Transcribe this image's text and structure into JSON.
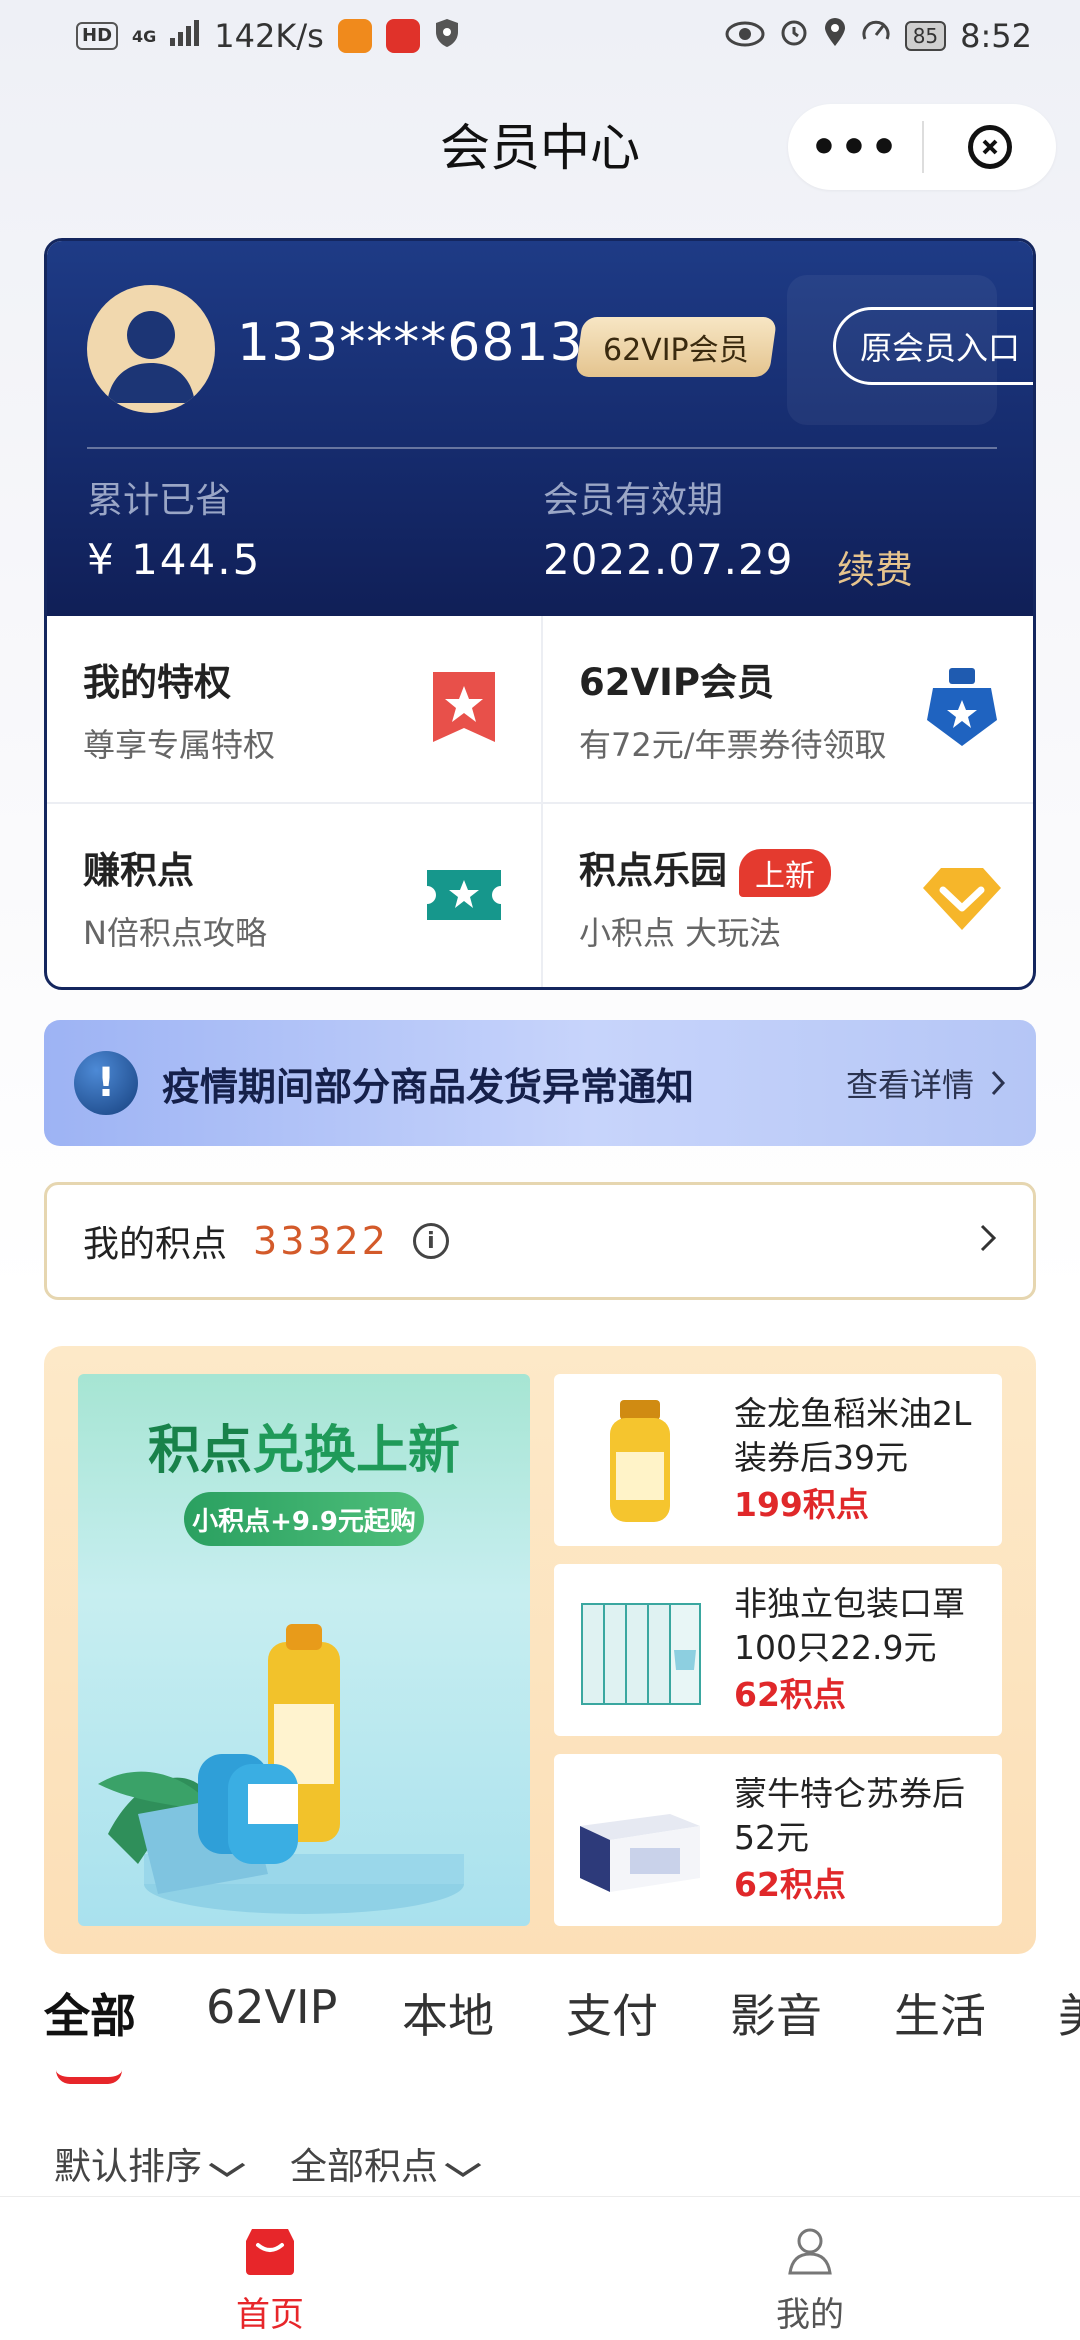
{
  "status_bar": {
    "left_badges": [
      "HD",
      "4G"
    ],
    "speed": "142K/s",
    "battery": "85",
    "time": "8:52"
  },
  "header": {
    "title": "会员中心",
    "more": "•••"
  },
  "card": {
    "phone": "133****6813",
    "vip_badge": "62VIP会员",
    "old_entry": "原会员入口",
    "saved_label": "累计已省",
    "saved_value": "¥ 144.5",
    "expiry_label": "会员有效期",
    "expiry_value": "2022.07.29",
    "renew": "续费"
  },
  "grid": [
    {
      "title": "我的特权",
      "subtitle": "尊享专属特权",
      "icon": "bookmark-star-icon"
    },
    {
      "title": "62VIP会员",
      "subtitle": "有72元/年票券待领取",
      "icon": "medal-star-icon"
    },
    {
      "title": "赚积点",
      "subtitle": "N倍积点攻略",
      "icon": "ticket-star-icon"
    },
    {
      "title": "积点乐园",
      "tag": "上新",
      "subtitle": "小积点 大玩法",
      "icon": "diamond-icon"
    }
  ],
  "notice": {
    "icon": "!",
    "text": "疫情期间部分商品发货异常通知",
    "link": "查看详情"
  },
  "points": {
    "label": "我的积点",
    "value": "33322"
  },
  "promo": {
    "banner_title_a": "积点",
    "banner_title_b": "兑换上新",
    "banner_pill": "小积点+9.9元起购",
    "products": [
      {
        "name": "金龙鱼稻米油2L装券后39元",
        "points": "199积点"
      },
      {
        "name": "非独立包装口罩100只22.9元",
        "points": "62积点"
      },
      {
        "name": "蒙牛特仑苏券后52元",
        "points": "62积点"
      }
    ]
  },
  "tabs": [
    "全部",
    "62VIP",
    "本地",
    "支付",
    "影音",
    "生活",
    "美"
  ],
  "filters": [
    "默认排序",
    "全部积点"
  ],
  "bottom_nav": [
    {
      "label": "首页",
      "active": true
    },
    {
      "label": "我的",
      "active": false
    }
  ],
  "colors": {
    "brand_red": "#e7262a",
    "card_navy": "#152a6b",
    "gold": "#e7c48d",
    "points_orange": "#d35a2a"
  }
}
